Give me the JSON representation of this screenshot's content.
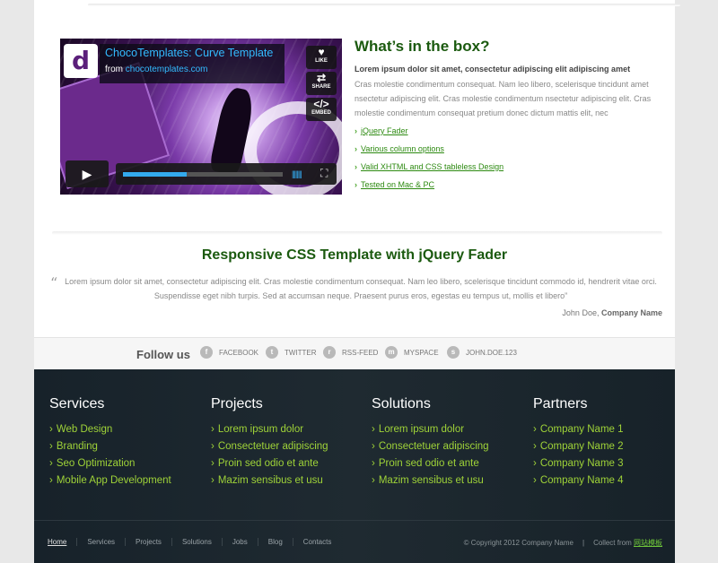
{
  "video": {
    "title": "ChocoTemplates: Curve Template",
    "from_label": "from",
    "from_link": "chocotemplates.com",
    "logo_letter": "d",
    "buttons": [
      {
        "label": "LIKE",
        "glyph": "♥"
      },
      {
        "label": "SHARE",
        "glyph": "⇄"
      },
      {
        "label": "EMBED",
        "glyph": "</>"
      }
    ],
    "progress": 0.4
  },
  "box": {
    "title": "What’s in the box?",
    "lead": "Lorem ipsum dolor sit amet, consectetur adipiscing elit adipiscing amet",
    "text": "Cras molestie condimentum consequat. Nam leo libero, scelerisque tincidunt amet nsectetur adipiscing elit. Cras molestie condimentum nsectetur adipiscing elit. Cras molestie condimentum consequat pretium donec dictum mattis elit, nec",
    "links": [
      "jQuery Fader",
      "Various column options",
      "Valid XHTML and CSS tableless Design",
      "Tested on Mac & PC"
    ]
  },
  "testimonial": {
    "title": "Responsive CSS Template with jQuery Fader",
    "quote": "Lorem ipsum dolor sit amet, consectetur adipiscing elit. Cras molestie condimentum consequat. Nam leo libero, scelerisque tincidunt commodo id, hendrerit vitae orci. Suspendisse eget nibh turpis. Sed at accumsan neque. Praesent purus eros, egestas eu tempus ut, mollis et libero”",
    "author": "John Doe,",
    "company": "Company Name"
  },
  "follow": {
    "label": "Follow us",
    "networks": [
      {
        "name": "FACEBOOK",
        "icon": "f"
      },
      {
        "name": "TWITTER",
        "icon": "t"
      },
      {
        "name": "RSS-FEED",
        "icon": "r"
      },
      {
        "name": "MYSPACE",
        "icon": "m"
      },
      {
        "name": "JOHN.DOE.123",
        "icon": "s"
      }
    ]
  },
  "footer": {
    "columns": [
      {
        "title": "Services",
        "items": [
          "Web Design",
          "Branding",
          "Seo Optimization",
          "Mobile App Development"
        ]
      },
      {
        "title": "Projects",
        "items": [
          "Lorem ipsum dolor",
          "Consectetuer adipiscing",
          "Proin sed odio et ante",
          "Mazim sensibus et usu"
        ]
      },
      {
        "title": "Solutions",
        "items": [
          "Lorem ipsum dolor",
          "Consectetuer adipiscing",
          "Proin sed odio et ante",
          "Mazim sensibus et usu"
        ]
      },
      {
        "title": "Partners",
        "items": [
          "Company Name 1",
          "Company Name 2",
          "Company Name 3",
          "Company Name 4"
        ]
      }
    ],
    "nav": [
      "Home",
      "Services",
      "Projects",
      "Solutions",
      "Jobs",
      "Blog",
      "Contacts"
    ],
    "copyright": "© Copyright 2012 Company Name",
    "separator": "|",
    "collect_label": "Collect from",
    "collect_source": "网站模板"
  },
  "colors": {
    "accent_green": "#1b5a0f",
    "link_green": "#2d8a11",
    "footer_green": "#9fd338",
    "footer_bg": "#1c272e"
  }
}
